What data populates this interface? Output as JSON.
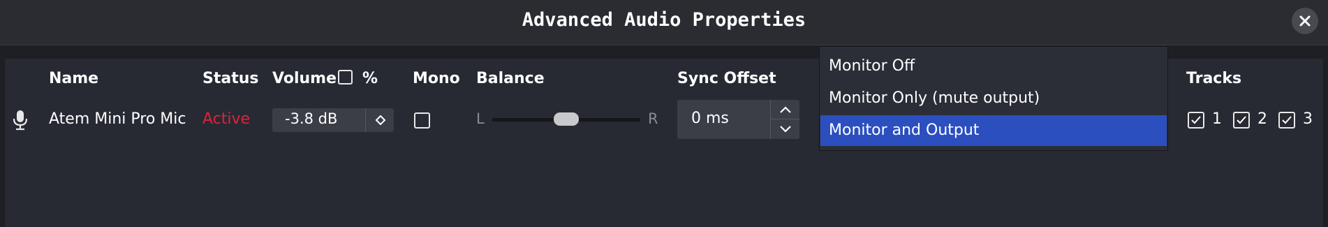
{
  "window": {
    "title": "Advanced Audio Properties",
    "close_icon": "close-icon"
  },
  "columns": {
    "name": "Name",
    "status": "Status",
    "volume": "Volume",
    "volume_percent": "%",
    "mono": "Mono",
    "balance": "Balance",
    "sync_offset": "Sync Offset",
    "tracks": "Tracks"
  },
  "row": {
    "icon": "microphone-icon",
    "name": "Atem Mini Pro Mic",
    "status": "Active",
    "status_color": "#e0213a",
    "volume": "-3.8 dB",
    "volume_percent_checked": false,
    "mono_checked": false,
    "balance_left": "L",
    "balance_right": "R",
    "balance_value": 0.5,
    "sync_offset": "0 ms",
    "tracks": [
      {
        "label": "1",
        "checked": true
      },
      {
        "label": "2",
        "checked": true
      },
      {
        "label": "3",
        "checked": true
      }
    ]
  },
  "monitoring_dropdown": {
    "options": [
      "Monitor Off",
      "Monitor Only (mute output)",
      "Monitor and Output"
    ],
    "selected": "Monitor and Output",
    "selected_color": "#2b4fbf"
  }
}
